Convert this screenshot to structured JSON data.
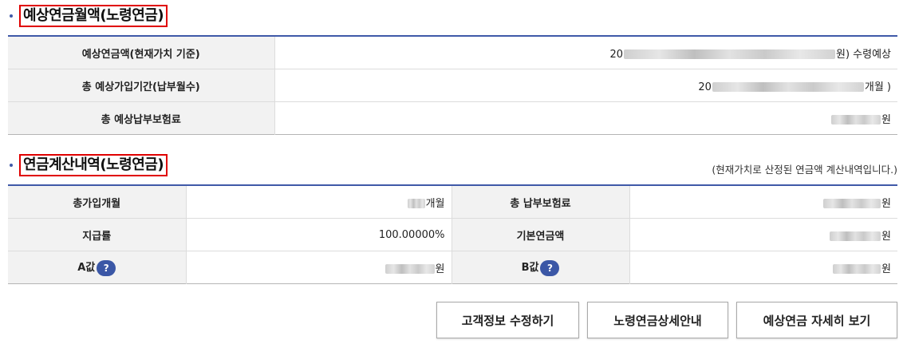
{
  "section1": {
    "title": "예상연금월액(노령연금)",
    "rows": [
      {
        "label": "예상연금액(현재가치 기준)",
        "prefix": "20",
        "suffix": "원) 수령예상"
      },
      {
        "label": "총 예상가입기간(납부월수)",
        "prefix": "20",
        "suffix": "개월 )"
      },
      {
        "label": "총 예상납부보험료",
        "prefix": "",
        "suffix": "원"
      }
    ]
  },
  "section2": {
    "title": "연금계산내역(노령연금)",
    "note": "(현재가치로 산정된 연금액 계산내역입니다.)",
    "rows": [
      {
        "label1": "총가입개월",
        "value1_suffix": "개월",
        "label2": "총 납부보험료",
        "value2_suffix": "원"
      },
      {
        "label1": "지급률",
        "value1": "100.00000%",
        "label2": "기본연금액",
        "value2_suffix": "원"
      },
      {
        "label1": "A값",
        "value1_suffix": "원",
        "label2": "B값",
        "value2_suffix": "원"
      }
    ],
    "help_glyph": "?"
  },
  "buttons": {
    "edit_info": "고객정보 수정하기",
    "pension_guide": "노령연금상세안내",
    "details": "예상연금 자세히 보기"
  }
}
